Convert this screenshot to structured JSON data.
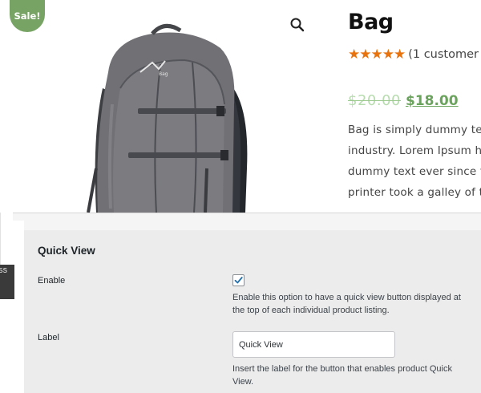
{
  "product": {
    "sale_badge": "Sale!",
    "title": "Bag",
    "stars": "★★★★★",
    "rating_value": 5,
    "review_text": "(1 customer",
    "old_price": "$20.00",
    "new_price": "$18.00",
    "description_lines": [
      "Bag is simply dummy text",
      "industry. Lorem Ipsum ha",
      "dummy text ever since th",
      "printer took a galley of ty"
    ],
    "zoom_icon": "magnifier-icon",
    "colors": {
      "sale": "#77a464",
      "price": "#6aa35c",
      "stars": "#e8720c"
    }
  },
  "edge_tab": {
    "label": "ass"
  },
  "settings": {
    "title": "Quick View",
    "enable": {
      "label": "Enable",
      "checked": true,
      "help": "Enable this option to have a quick view button displayed at the top of each individual product listing."
    },
    "label_field": {
      "label": "Label",
      "value": "Quick View",
      "help": "Insert the label for the button that enables product Quick View."
    }
  }
}
